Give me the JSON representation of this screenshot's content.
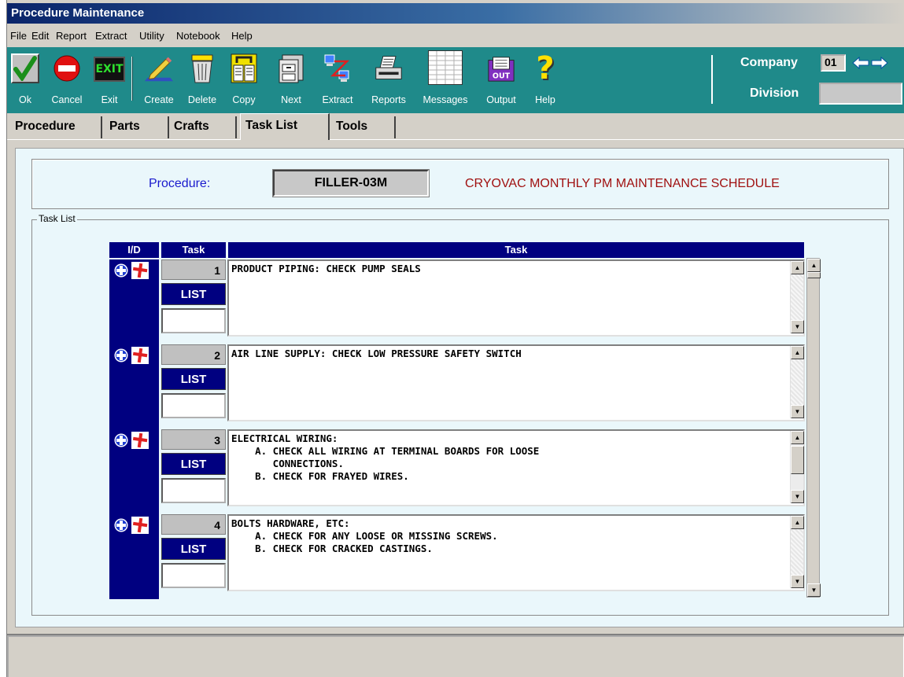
{
  "window": {
    "title": "Procedure Maintenance"
  },
  "menu": [
    "File",
    "Edit",
    "Report",
    "Extract",
    "Utility",
    "Notebook",
    "Help"
  ],
  "toolbar": {
    "buttons": [
      {
        "label": "Ok",
        "icon": "checkmark-icon"
      },
      {
        "label": "Cancel",
        "icon": "stop-icon"
      },
      {
        "label": "Exit",
        "icon": "exit-sign-icon",
        "icon_text": "EXIT"
      },
      {
        "label": "Create",
        "icon": "pencil-icon"
      },
      {
        "label": "Delete",
        "icon": "trash-can-icon"
      },
      {
        "label": "Copy",
        "icon": "copy-icon"
      },
      {
        "label": "Next",
        "icon": "file-cabinet-icon"
      },
      {
        "label": "Extract",
        "icon": "extract-computers-icon"
      },
      {
        "label": "Reports",
        "icon": "printer-icon"
      },
      {
        "label": "Messages",
        "icon": "messages-sheet-icon"
      },
      {
        "label": "Output",
        "icon": "output-box-icon",
        "icon_text": "OUT"
      },
      {
        "label": "Help",
        "icon": "question-mark-icon",
        "icon_text": "?"
      }
    ],
    "company_label": "Company",
    "company_value": "01",
    "division_label": "Division",
    "division_value": ""
  },
  "tabs": [
    "Procedure",
    "Parts",
    "Crafts",
    "Task List",
    "Tools"
  ],
  "active_tab": "Task List",
  "procedure": {
    "label": "Procedure:",
    "code": "FILLER-03M",
    "description": "CRYOVAC MONTHLY PM MAINTENANCE SCHEDULE"
  },
  "task_list": {
    "group_label": "Task List",
    "headers": {
      "id": "I/D",
      "task_num": "Task",
      "task_text": "Task"
    },
    "list_label": "LIST",
    "rows": [
      {
        "num": "1",
        "text": "PRODUCT PIPING: CHECK PUMP SEALS"
      },
      {
        "num": "2",
        "text": "AIR LINE SUPPLY: CHECK LOW PRESSURE SAFETY SWITCH"
      },
      {
        "num": "3",
        "text": "ELECTRICAL WIRING:\n    A. CHECK ALL WIRING AT TERMINAL BOARDS FOR LOOSE\n       CONNECTIONS.\n    B. CHECK FOR FRAYED WIRES."
      },
      {
        "num": "4",
        "text": "BOLTS HARDWARE, ETC:\n    A. CHECK FOR ANY LOOSE OR MISSING SCREWS.\n    B. CHECK FOR CRACKED CASTINGS."
      }
    ]
  },
  "status": {
    "text": ""
  },
  "colors": {
    "toolbar": "#1f8a8a",
    "header": "#000080",
    "panel": "#eaf7fb",
    "procedure_label": "#1a1acd",
    "procedure_desc": "#a01010"
  }
}
